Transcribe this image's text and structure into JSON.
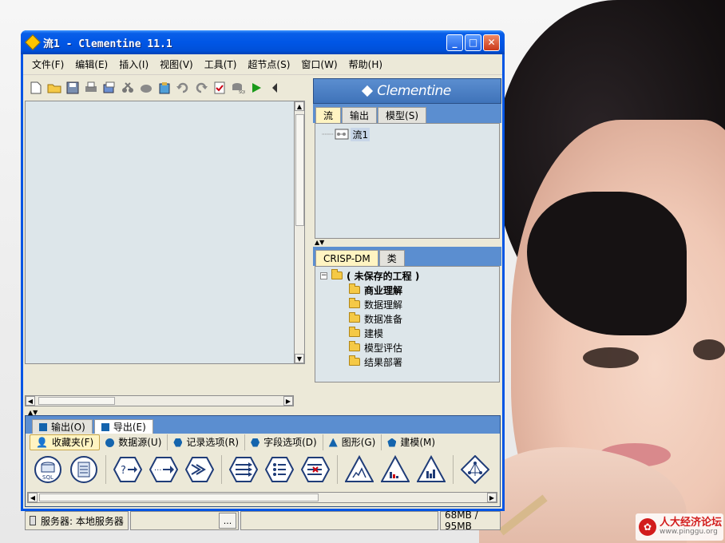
{
  "window": {
    "title": "流1 - Clementine 11.1"
  },
  "menu": [
    "文件(F)",
    "编辑(E)",
    "插入(I)",
    "视图(V)",
    "工具(T)",
    "超节点(S)",
    "窗口(W)",
    "帮助(H)"
  ],
  "brand": {
    "name": "Clementine"
  },
  "manager_tabs": [
    "流",
    "输出",
    "模型(S)"
  ],
  "stream_tree": {
    "item": "流1"
  },
  "project_tabs": [
    "CRISP-DM",
    "类"
  ],
  "project_tree": {
    "root": "( 未保存的工程 )",
    "children": [
      "商业理解",
      "数据理解",
      "数据准备",
      "建模",
      "模型评估",
      "结果部署"
    ]
  },
  "output_tabs": [
    "输出(O)",
    "导出(E)"
  ],
  "palette_tabs": [
    "收藏夹(F)",
    "数据源(U)",
    "记录选项(R)",
    "字段选项(D)",
    "图形(G)",
    "建模(M)"
  ],
  "palette_nodes": [
    {
      "icon": "sql"
    },
    {
      "icon": "file"
    },
    {
      "icon": "select"
    },
    {
      "icon": "sample"
    },
    {
      "icon": "merge"
    },
    {
      "icon": "derive"
    },
    {
      "icon": "filter"
    },
    {
      "icon": "type"
    },
    {
      "icon": "plot"
    },
    {
      "icon": "histogram"
    },
    {
      "icon": "distribution"
    },
    {
      "icon": "neural-net"
    }
  ],
  "node_labels": {
    "sql": "SQL"
  },
  "status": {
    "server": "服务器: 本地服务器",
    "ellipsis": "...",
    "memory": "68MB / 95MB"
  },
  "watermark": {
    "title": "人大经济论坛",
    "url": "www.pinggu.org"
  }
}
